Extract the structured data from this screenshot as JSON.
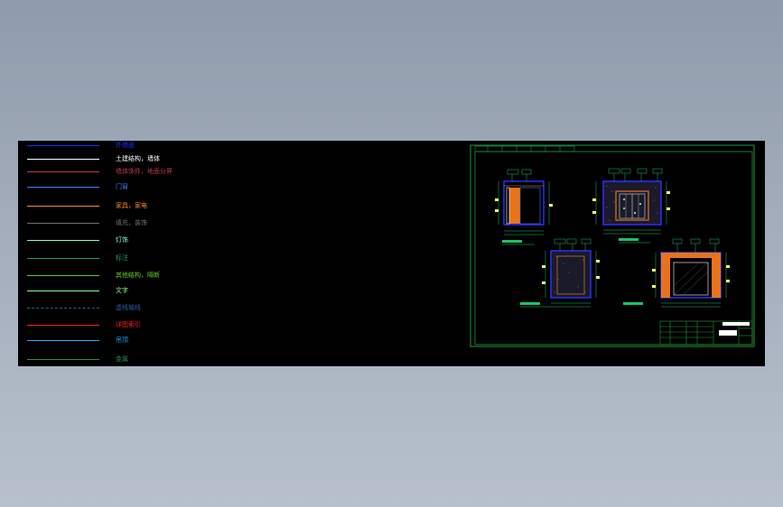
{
  "legend": [
    {
      "label": "外墙面",
      "color": "#1c2cff",
      "style": "solid"
    },
    {
      "label": "土建结构，墙体",
      "color": "#ffffff",
      "style": "solid"
    },
    {
      "label": "墙体饰件，地面分界",
      "color": "#c03a40",
      "style": "solid"
    },
    {
      "label": "门窗",
      "color": "#3f7fff",
      "style": "solid"
    },
    {
      "label": "家具，家电",
      "color": "#ff8a2a",
      "style": "solid"
    },
    {
      "label": "填充，装饰",
      "color": "#707070",
      "style": "solid"
    },
    {
      "label": "灯饰",
      "color": "#7fffd0",
      "style": "solid"
    },
    {
      "label": "标注",
      "color": "#20a060",
      "style": "solid"
    },
    {
      "label": "其他结构，隔断",
      "color": "#66cc22",
      "style": "solid"
    },
    {
      "label": "文字",
      "color": "#88ff88",
      "style": "solid"
    },
    {
      "label": "虚线轴线",
      "color": "#2e5aa0",
      "style": "dashed"
    },
    {
      "label": "详图索引",
      "color": "#ff2020",
      "style": "solid"
    },
    {
      "label": "吊顶",
      "color": "#22aaff",
      "style": "solid"
    },
    {
      "label": "金属",
      "color": "#2e8b57",
      "style": "solid"
    }
  ],
  "colors": {
    "frame": "#1f9a3a",
    "wall": "#2a2fff",
    "dimension": "#17c46a",
    "furniture": "#e8731a",
    "text": "#88ff88"
  }
}
